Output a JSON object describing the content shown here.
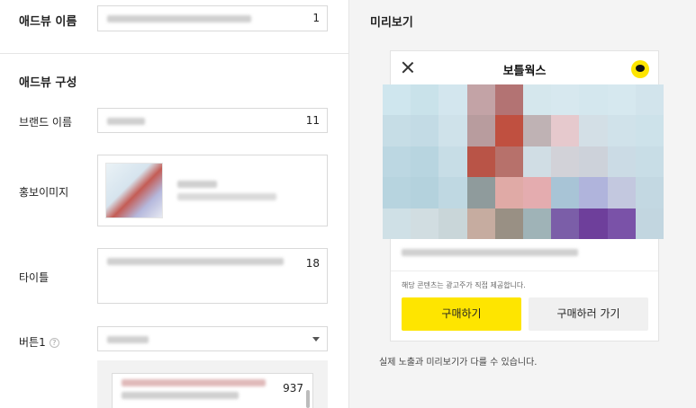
{
  "form": {
    "adview_name_label": "애드뷰 이름",
    "adview_name_count": "1",
    "section_title": "애드뷰 구성",
    "brand_name_label": "브랜드 이름",
    "brand_name_count": "11",
    "promo_image_label": "홍보이미지",
    "title_label": "타이틀",
    "title_count": "18",
    "button1_label": "버튼1",
    "button1_help": "?",
    "button1_count": "937"
  },
  "preview": {
    "section_title": "미리보기",
    "header_title": "보틀웍스",
    "notice": "해당 콘텐츠는 광고주가 직접 제공합니다.",
    "primary_button": "구매하기",
    "secondary_button": "구매하러 가기",
    "footnote": "실제 노출과 미리보기가 다를 수 있습니다."
  },
  "colors": {
    "accent": "#fee500",
    "mosaic": [
      "#cfe6ee",
      "#c9e2ea",
      "#d3e6ee",
      "#c3a3a6",
      "#b37373",
      "#d5e7ed",
      "#d7e8ef",
      "#d4e7ee",
      "#d6e8ef",
      "#d2e4ec",
      "#c6dde6",
      "#c3dbe5",
      "#cfe2ea",
      "#b89c9e",
      "#c05040",
      "#bfb2b4",
      "#e6c9cd",
      "#d3dfe6",
      "#d0e2ea",
      "#cde2ea",
      "#bcd7e2",
      "#b8d5e0",
      "#c7dde6",
      "#b95447",
      "#b7716b",
      "#d0dde4",
      "#d2d2d8",
      "#cdd2da",
      "#cbdbe5",
      "#c8dde6",
      "#b7d4df",
      "#b4d2dd",
      "#bfd8e2",
      "#8f9b9c",
      "#e0aaa6",
      "#e4acaf",
      "#a8c4d6",
      "#b0b4dc",
      "#c3c8df",
      "#c3d8e2",
      "#cfe0e6",
      "#d1dde1",
      "#c9d6d9",
      "#c6aca0",
      "#999084",
      "#9fb3b7",
      "#7b5ea8",
      "#6e3f9b",
      "#7a52a8",
      "#c2d6e0"
    ]
  }
}
